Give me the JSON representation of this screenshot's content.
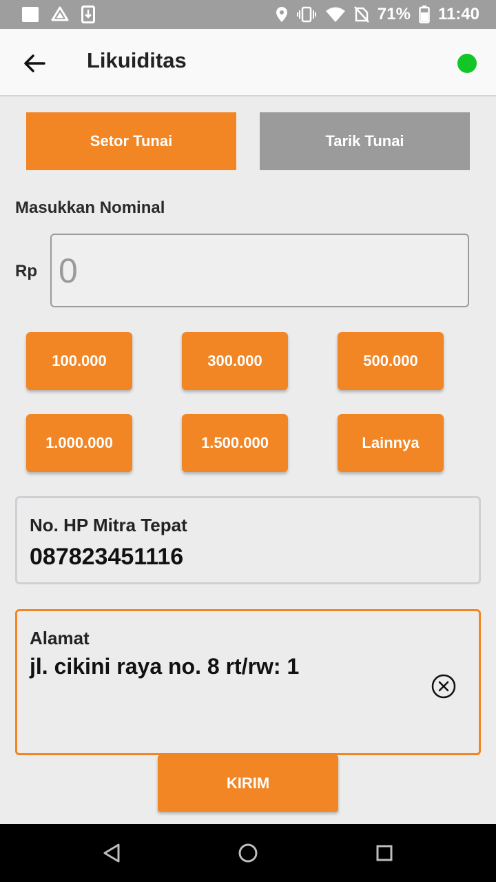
{
  "status_bar": {
    "battery": "71%",
    "time": "11:40",
    "icons": [
      "notification-square-icon",
      "drive-icon",
      "download-icon",
      "location-icon",
      "vibrate-icon",
      "wifi-icon",
      "no-sim-icon",
      "battery-icon"
    ]
  },
  "app_bar": {
    "title": "Likuiditas",
    "back_icon": "arrow-left-icon",
    "status_color": "#11c626"
  },
  "tabs": [
    {
      "label": "Setor Tunai",
      "active": true
    },
    {
      "label": "Tarik Tunai",
      "active": false
    }
  ],
  "nominal": {
    "label": "Masukkan Nominal",
    "currency": "Rp",
    "placeholder": "0"
  },
  "presets": [
    "100.000",
    "300.000",
    "500.000",
    "1.000.000",
    "1.500.000",
    "Lainnya"
  ],
  "phone_card": {
    "label": "No. HP Mitra Tepat",
    "value": "087823451116"
  },
  "address_card": {
    "label": "Alamat",
    "value": "jl. cikini raya no. 8 rt/rw: 1",
    "clear_icon": "close-circle-icon"
  },
  "submit_label": "KIRIM",
  "colors": {
    "accent": "#f28524",
    "inactive": "#9b9b9b"
  }
}
